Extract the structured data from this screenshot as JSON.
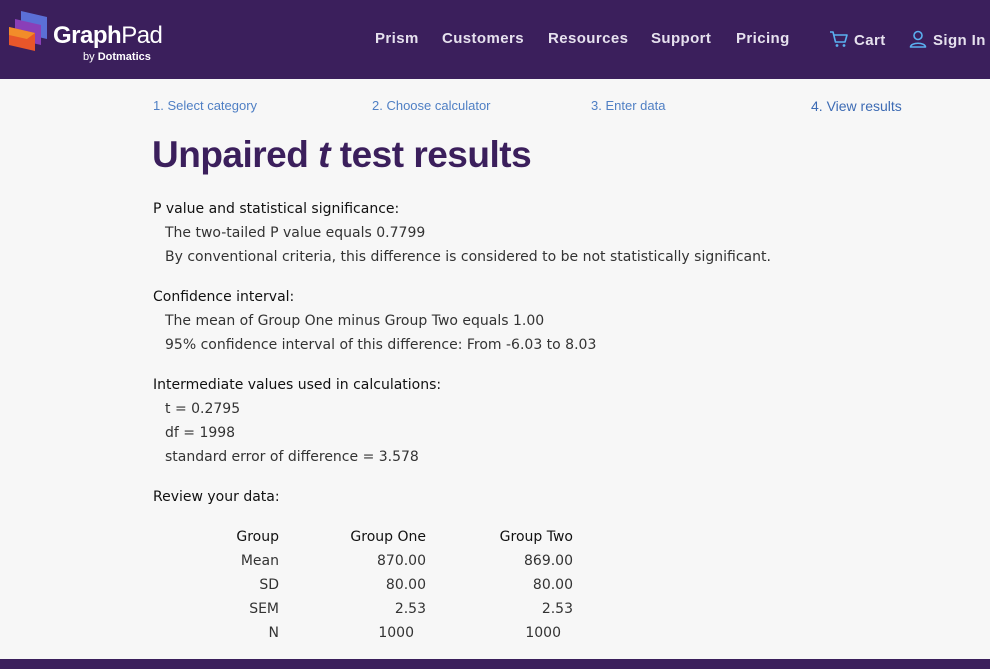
{
  "header": {
    "logo_text_bold": "Graph",
    "logo_text_regular": "Pad",
    "logo_sub_prefix": "by ",
    "logo_sub_brand": "Dotmatics",
    "nav": [
      "Prism",
      "Customers",
      "Resources",
      "Support",
      "Pricing"
    ],
    "cart_label": "Cart",
    "signin_label": "Sign In",
    "cart_icon": "shopping-cart-icon",
    "signin_icon": "user-icon"
  },
  "steps": [
    "1. Select category",
    "2. Choose calculator",
    "3. Enter data",
    "4. View results"
  ],
  "title": {
    "prefix": "Unpaired ",
    "italic": "t",
    "suffix": " test results"
  },
  "sections": {
    "pvalue": {
      "heading": "P value and statistical significance:",
      "lines": [
        "The two-tailed P value equals 0.7799",
        "By conventional criteria, this difference is considered to be not statistically significant."
      ]
    },
    "ci": {
      "heading": "Confidence interval:",
      "lines": [
        "The mean of Group One minus Group Two equals 1.00",
        "95% confidence interval of this difference: From -6.03 to 8.03"
      ]
    },
    "intermediate": {
      "heading": "Intermediate values used in calculations:",
      "lines": [
        "t = 0.2795",
        "df = 1998",
        "standard error of difference = 3.578"
      ]
    },
    "review": {
      "heading": "Review your data:"
    }
  },
  "table": {
    "headers": [
      "Group",
      "Group One",
      "Group Two"
    ],
    "rows": [
      [
        "Mean",
        "870.00",
        "869.00"
      ],
      [
        "SD",
        "80.00",
        "80.00"
      ],
      [
        "SEM",
        "2.53",
        "2.53"
      ],
      [
        "N",
        "1000",
        "1000"
      ]
    ]
  },
  "colors": {
    "brand_purple": "#3b1f5c",
    "link_blue": "#4f7fc4",
    "background": "#f7f7f7"
  }
}
